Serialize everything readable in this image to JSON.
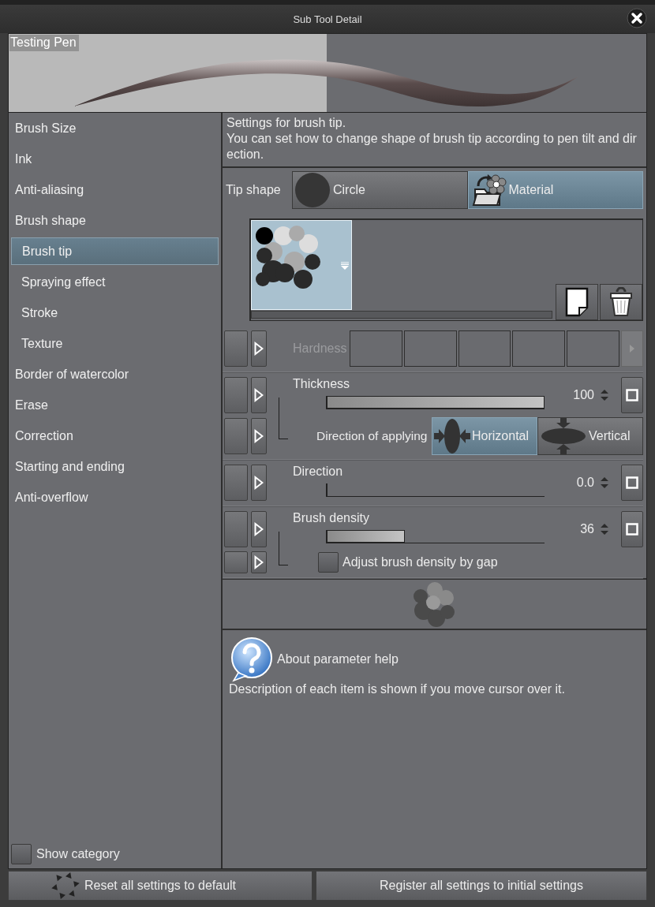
{
  "window": {
    "title": "Sub Tool Detail"
  },
  "preview": {
    "label": "Testing Pen"
  },
  "sidebar": {
    "items": [
      {
        "label": "Brush Size",
        "selected": false
      },
      {
        "label": "Ink",
        "selected": false
      },
      {
        "label": "Anti-aliasing",
        "selected": false
      },
      {
        "label": "Brush shape",
        "selected": false,
        "children": [
          {
            "label": "Brush tip",
            "selected": true
          },
          {
            "label": "Spraying effect",
            "selected": false
          },
          {
            "label": "Stroke",
            "selected": false
          },
          {
            "label": "Texture",
            "selected": false
          }
        ]
      },
      {
        "label": "Border of watercolor",
        "selected": false
      },
      {
        "label": "Erase",
        "selected": false
      },
      {
        "label": "Correction",
        "selected": false
      },
      {
        "label": "Starting and ending",
        "selected": false
      },
      {
        "label": "Anti-overflow",
        "selected": false
      }
    ],
    "show_category": {
      "label": "Show category",
      "checked": false
    }
  },
  "description": [
    "Settings for brush tip.",
    "You can set how to change shape of brush tip according to pen tilt and direction."
  ],
  "tip_shape": {
    "label": "Tip shape",
    "options": [
      {
        "label": "Circle",
        "selected": false
      },
      {
        "label": "Material",
        "selected": true
      }
    ]
  },
  "materials": [
    {
      "selected": true
    }
  ],
  "params": [
    {
      "kind": "segments",
      "label": "Hardness",
      "disabled": true
    },
    {
      "kind": "slider",
      "label": "Thickness",
      "value": "100",
      "level": 1,
      "children": [
        {
          "kind": "choice",
          "label": "Direction of applying",
          "options": [
            {
              "label": "Horizontal",
              "selected": true
            },
            {
              "label": "Vertical",
              "selected": false
            }
          ]
        }
      ]
    },
    {
      "kind": "slider",
      "label": "Direction",
      "value": "0.0",
      "level": 0
    },
    {
      "kind": "slider",
      "label": "Brush density",
      "value": "36",
      "level": 0.36,
      "children": [
        {
          "kind": "checkbox",
          "label": "Adjust brush density by gap",
          "checked": false
        }
      ]
    }
  ],
  "help": {
    "title": "About parameter help",
    "text": "Description of each item is shown if you move cursor over it."
  },
  "buttons": [
    "Reset all settings to default",
    "Register all settings to initial settings"
  ]
}
